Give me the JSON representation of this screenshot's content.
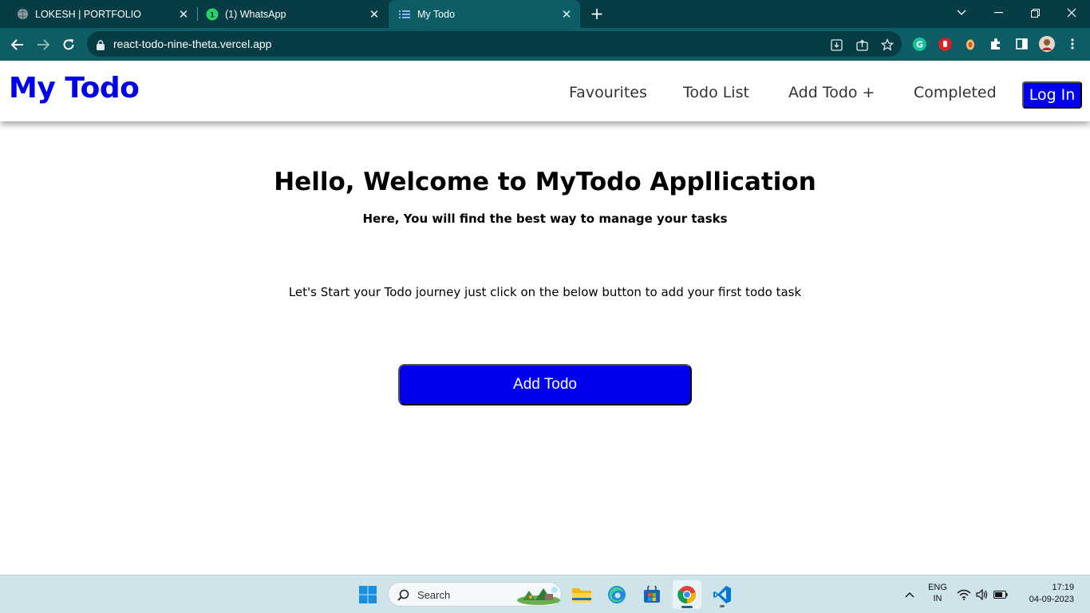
{
  "browser": {
    "tabs": [
      {
        "title": "LOKESH | PORTFOLIO",
        "icon": "globe-icon",
        "active": false
      },
      {
        "title": "(1) WhatsApp",
        "icon": "whatsapp-icon",
        "active": false
      },
      {
        "title": "My Todo",
        "icon": "list-icon",
        "active": true
      }
    ],
    "url": "react-todo-nine-theta.vercel.app"
  },
  "app": {
    "brand": "My Todo",
    "nav": [
      "Favourites",
      "Todo List",
      "Add Todo +",
      "Completed"
    ],
    "login_label": "Log In",
    "welcome_title": "Hello, Welcome to MyTodo Appllication",
    "subtitle": "Here, You will find the best way to manage your tasks",
    "hint": "Let's Start your Todo journey just click on the below button to add your first todo task",
    "add_button_label": "Add Todo",
    "accent_color": "#0000ee"
  },
  "taskbar": {
    "search_label": "Search",
    "lang_line1": "ENG",
    "lang_line2": "IN",
    "time": "17:19",
    "date": "04-09-2023"
  }
}
